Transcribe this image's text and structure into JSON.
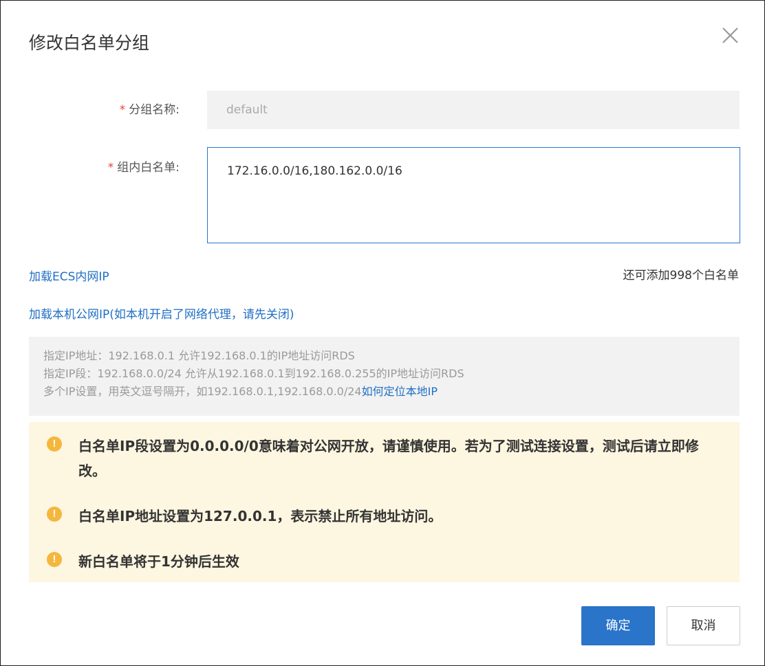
{
  "dialog": {
    "title": "修改白名单分组",
    "close_icon": "close-icon"
  },
  "form": {
    "group_name": {
      "required_mark": "*",
      "label": "分组名称:",
      "value": "default"
    },
    "whitelist": {
      "required_mark": "*",
      "label": "组内白名单:",
      "value": "172.16.0.0/16,180.162.0.0/16"
    }
  },
  "links": {
    "load_ecs": "加载ECS内网IP",
    "load_public": "加载本机公网IP(如本机开启了网络代理，请先关闭)"
  },
  "remaining": "还可添加998个白名单",
  "hint": {
    "line1": "指定IP地址：192.168.0.1 允许192.168.0.1的IP地址访问RDS",
    "line2": "指定IP段：192.168.0.0/24 允许从192.168.0.1到192.168.0.255的IP地址访问RDS",
    "line3": "多个IP设置，用英文逗号隔开，如192.168.0.1,192.168.0.0/24",
    "line3_link": "如何定位本地IP"
  },
  "warnings": {
    "icon": "warning-icon",
    "icon_glyph": "!",
    "items": [
      "白名单IP段设置为0.0.0.0/0意味着对公网开放，请谨慎使用。若为了测试连接设置，测试后请立即修改。",
      "白名单IP地址设置为127.0.0.1，表示禁止所有地址访问。",
      "新白名单将于1分钟后生效"
    ]
  },
  "buttons": {
    "ok": "确定",
    "cancel": "取消"
  },
  "colors": {
    "primary": "#2a74c9",
    "link": "#1f6fc4",
    "required": "#e8453c",
    "warning_bg": "#fdf6e0",
    "warning_icon": "#f4b73e"
  }
}
